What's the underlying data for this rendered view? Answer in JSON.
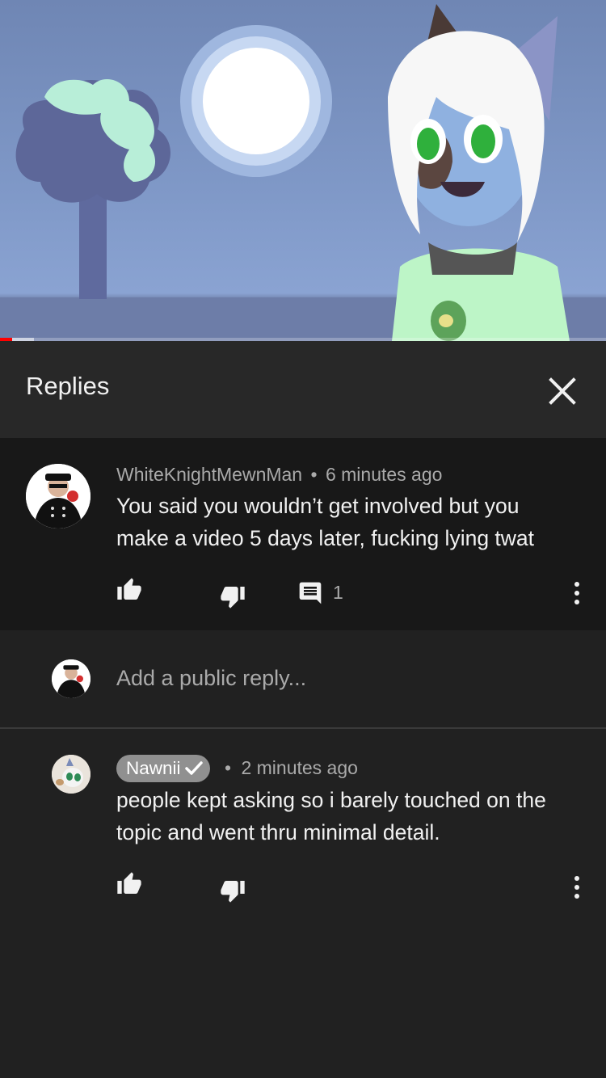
{
  "replies_panel": {
    "title": "Replies",
    "close_icon": "close-icon"
  },
  "video": {
    "progress_played_fraction": 0.02,
    "progress_buffered_fraction": 0.056
  },
  "parent_comment": {
    "author": "WhiteKnightMewnMan",
    "separator": "•",
    "time": "6 minutes ago",
    "text_line1": "You said you wouldn’t get involved but you",
    "text_line2": "make a video 5 days later, fucking lying twat",
    "reply_count": "1",
    "icons": [
      "thumb-up-icon",
      "thumb-down-icon",
      "comment-icon",
      "more-vert-icon"
    ]
  },
  "add_reply": {
    "placeholder": "Add a public reply..."
  },
  "reply": {
    "author": "Nawnii",
    "verified_icon": "check-icon",
    "separator": "•",
    "time": "2 minutes ago",
    "text_line1": "people kept asking so i barely touched on the",
    "text_line2": "topic and went thru minimal detail.",
    "icons": [
      "thumb-up-icon",
      "thumb-down-icon",
      "more-vert-icon"
    ]
  },
  "colors": {
    "background": "#212121",
    "header_background": "#282828",
    "parent_background": "#181818",
    "secondary_text": "#aaaaaa",
    "progress_red": "#ff0000"
  }
}
